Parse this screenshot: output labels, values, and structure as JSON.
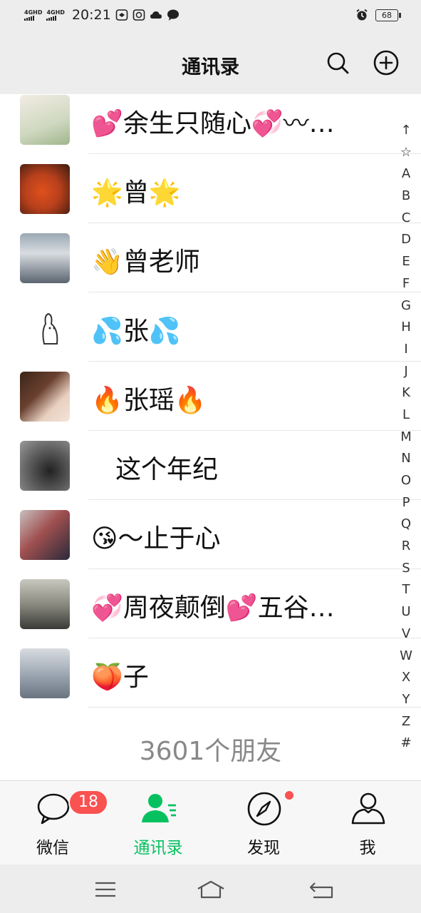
{
  "status_bar": {
    "signal_1": "4GHD",
    "signal_2": "4GHD",
    "time": "20:21",
    "battery": "68",
    "icons": [
      "notification-icon",
      "mail-icon",
      "cloud-icon",
      "chat-icon",
      "alarm-icon"
    ]
  },
  "header": {
    "title": "通讯录",
    "search_icon": "search-icon",
    "add_icon": "add-circle-icon"
  },
  "contacts": [
    {
      "name": "💕余生只随心💞〰…",
      "avatar_color": "#cfd8c0"
    },
    {
      "name": "🌟曾🌟",
      "avatar_color": "#b8401c"
    },
    {
      "name": "👋曾老师",
      "avatar_color": "#7a8c9a"
    },
    {
      "name": "💦张💦",
      "avatar_color": "#ffffff"
    },
    {
      "name": "🔥张瑶🔥",
      "avatar_color": "#6a4030"
    },
    {
      "name": "这个年纪",
      "avatar_color": "#5c5c5c"
    },
    {
      "name": "😘～止于心",
      "avatar_color": "#a05050"
    },
    {
      "name": "💞周夜颠倒💕五谷…",
      "avatar_color": "#8a8a80"
    },
    {
      "name": "🍑子",
      "avatar_color": "#9aa4b0"
    }
  ],
  "friend_count": "3601个朋友",
  "index_letters": [
    "↑",
    "☆",
    "A",
    "B",
    "C",
    "D",
    "E",
    "F",
    "G",
    "H",
    "I",
    "J",
    "K",
    "L",
    "M",
    "N",
    "O",
    "P",
    "Q",
    "R",
    "S",
    "T",
    "U",
    "V",
    "W",
    "X",
    "Y",
    "Z",
    "#"
  ],
  "tabs": [
    {
      "label": "微信",
      "icon": "chat-bubble-icon",
      "badge": "18"
    },
    {
      "label": "通讯录",
      "icon": "contacts-icon"
    },
    {
      "label": "发现",
      "icon": "compass-icon"
    },
    {
      "label": "我",
      "icon": "person-icon"
    }
  ],
  "colors": {
    "accent": "#07c160",
    "badge": "#fa5151"
  }
}
